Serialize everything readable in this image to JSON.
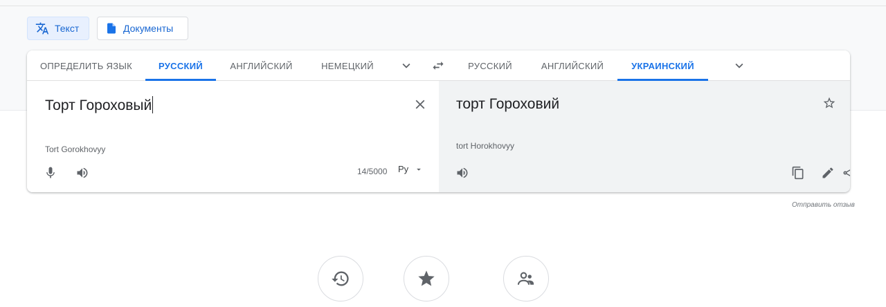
{
  "modes": {
    "text_label": "Текст",
    "docs_label": "Документы"
  },
  "source_langs": [
    "ОПРЕДЕЛИТЬ ЯЗЫК",
    "РУССКИЙ",
    "АНГЛИЙСКИЙ",
    "НЕМЕЦКИЙ"
  ],
  "target_langs": [
    "РУССКИЙ",
    "АНГЛИЙСКИЙ",
    "УКРАИНСКИЙ"
  ],
  "source_active": "РУССКИЙ",
  "target_active": "УКРАИНСКИЙ",
  "source": {
    "text": "Торт Гороховый",
    "transliteration": "Tort Gorokhovyy",
    "char_count": "14/5000",
    "keyboard_label": "Ру"
  },
  "target": {
    "text": "торт Гороховий",
    "transliteration": "tort Horokhovyy"
  },
  "feedback_label": "Отправить отзыв",
  "colors": {
    "accent": "#1a73e8",
    "mode_active_bg": "#e8f0fe",
    "target_pane_bg": "#f1f3f4"
  },
  "icons": {
    "translate": "translate-icon",
    "document": "document-icon",
    "chevron": "chevron-down-icon",
    "swap": "swap-icon",
    "clear": "close-icon",
    "star": "star-outline-icon",
    "mic": "mic-icon",
    "speaker": "speaker-icon",
    "copy": "copy-icon",
    "edit": "pencil-icon",
    "share": "share-icon",
    "history": "history-icon",
    "saved": "star-icon",
    "community": "community-icon"
  }
}
